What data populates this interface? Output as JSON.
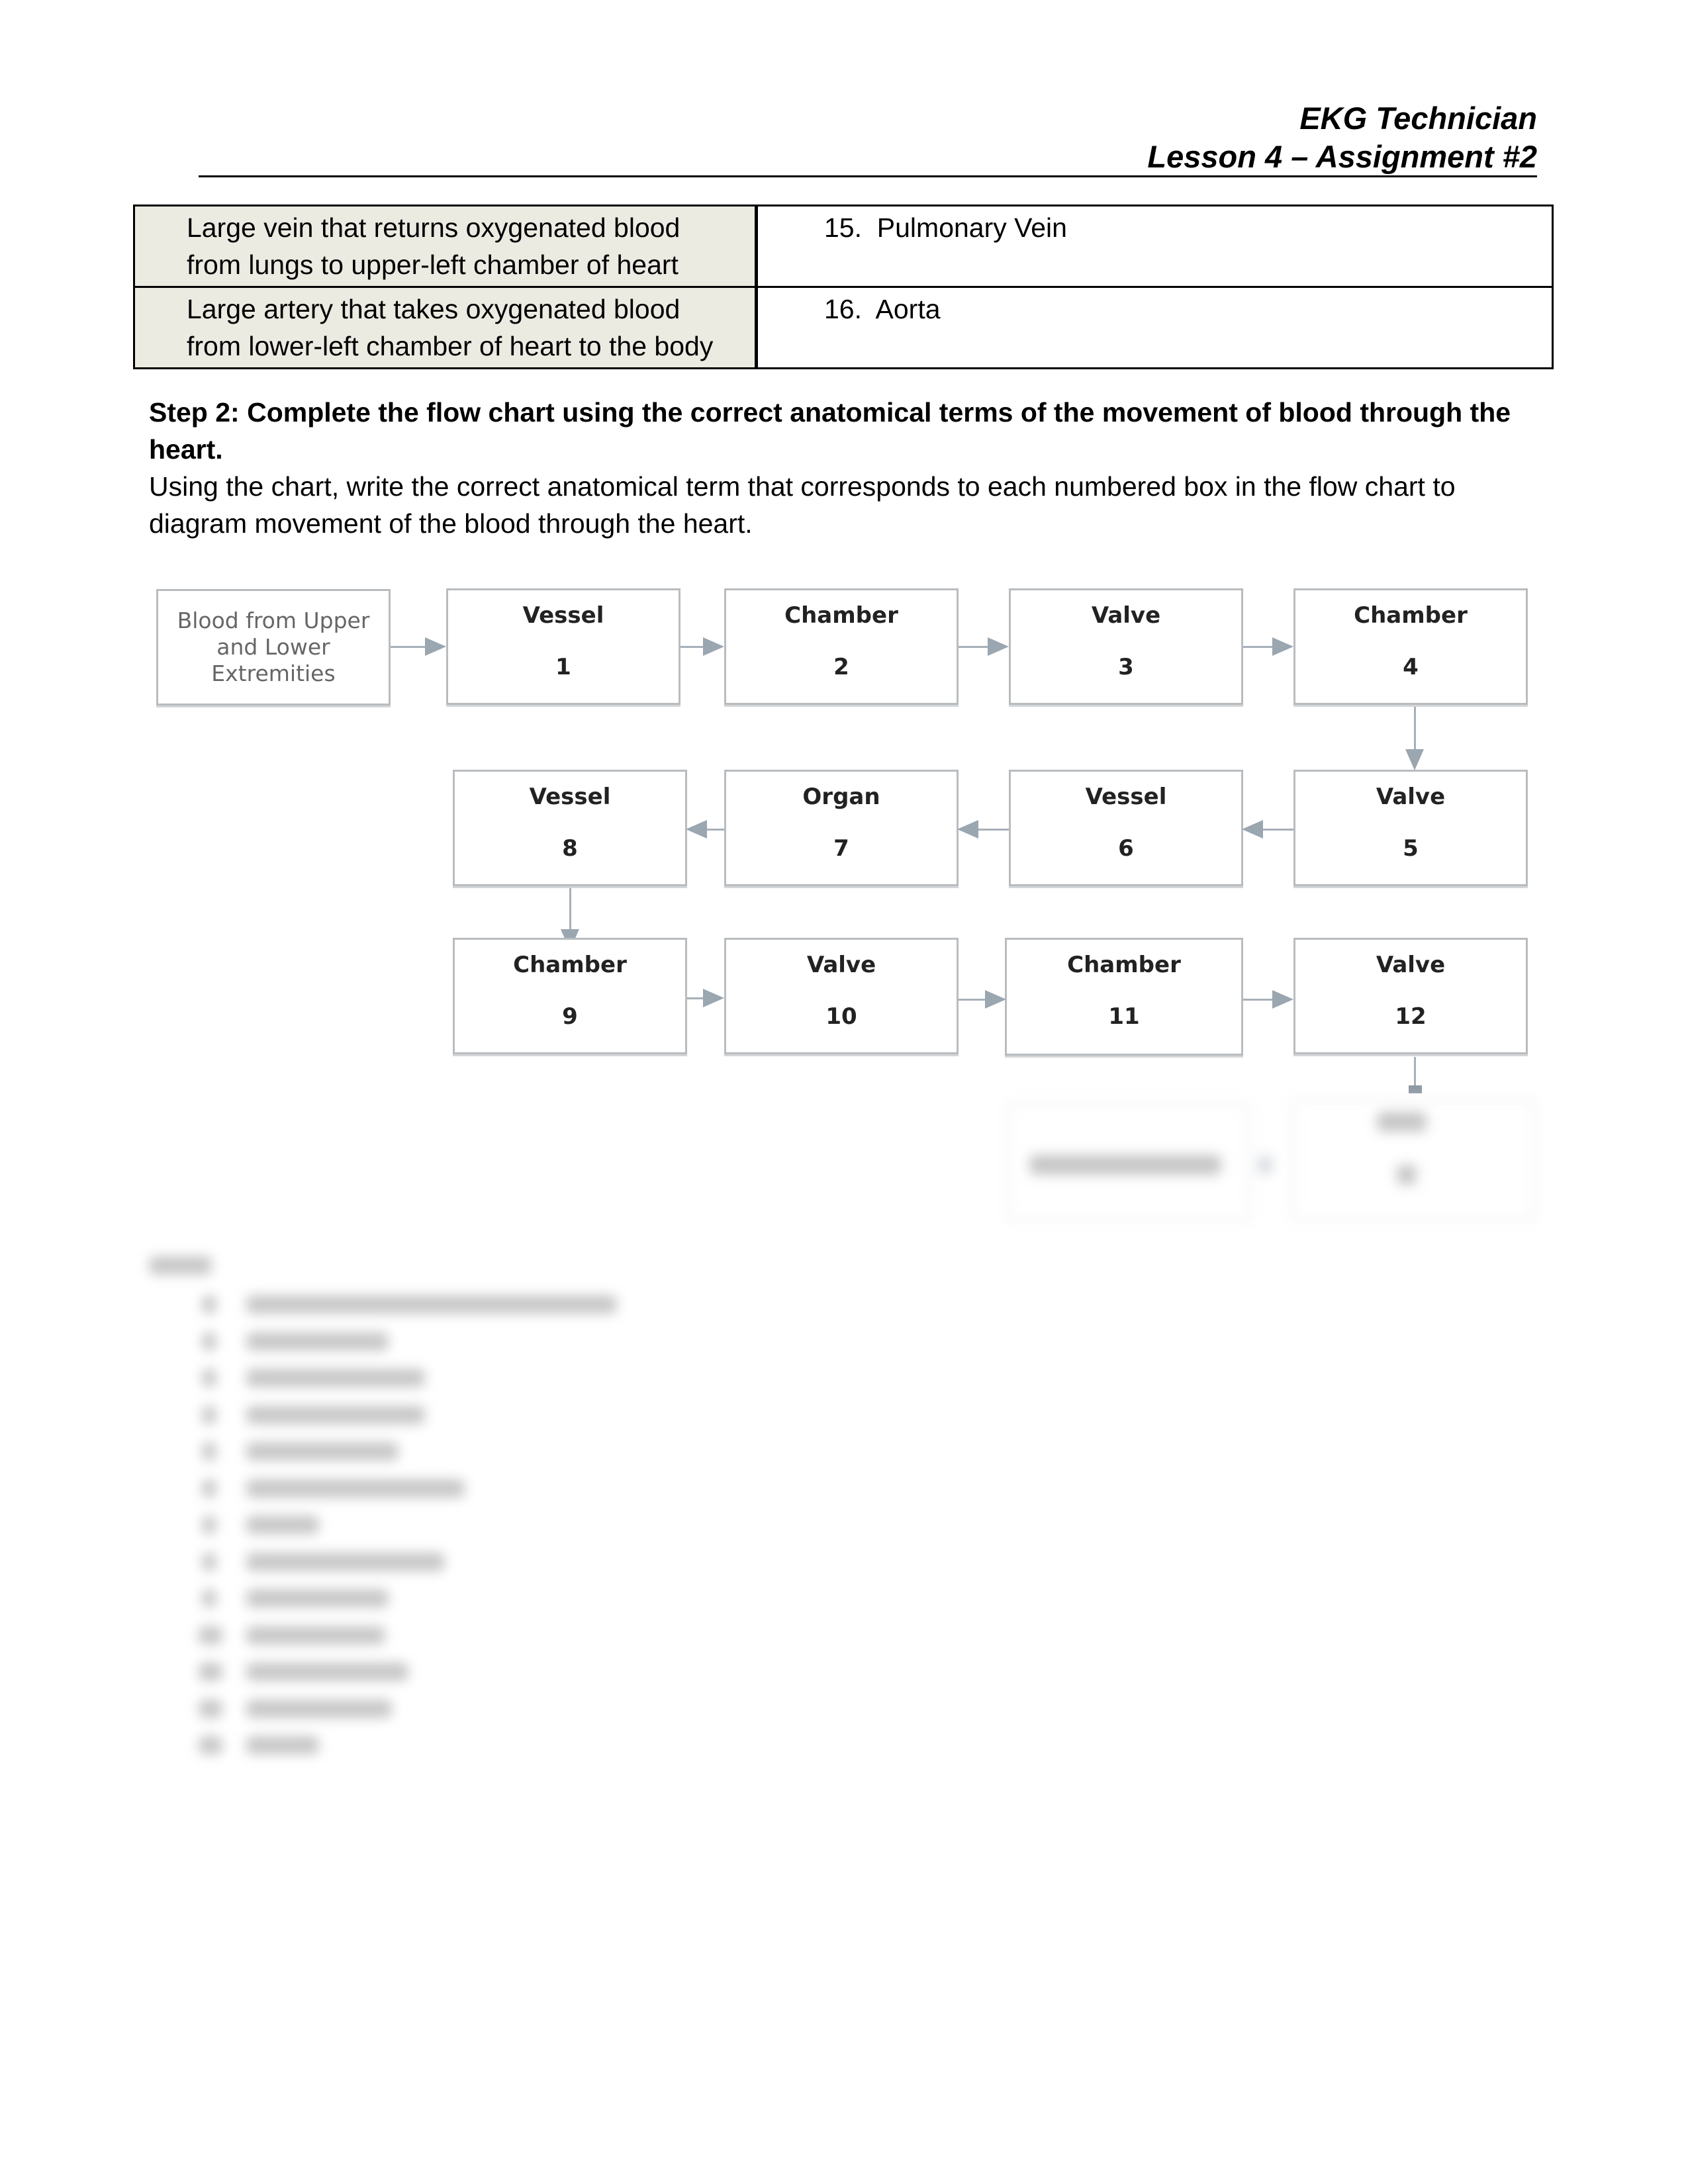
{
  "header": {
    "course": "EKG Technician",
    "lesson": "Lesson 4 – Assignment #2"
  },
  "terms_table": {
    "rows": [
      {
        "description_line1": "Large vein that returns oxygenated blood",
        "description_line2": "from lungs to upper-left chamber of heart",
        "answer": "15.  Pulmonary Vein"
      },
      {
        "description_line1": "Large artery that takes oxygenated blood",
        "description_line2": "from lower-left chamber of heart to the body",
        "answer": "16.  Aorta"
      }
    ]
  },
  "step2": {
    "heading": "Step 2: Complete the flow chart using the correct anatomical terms of the movement of blood through the heart.",
    "instructions": "Using the chart, write the correct anatomical term that corresponds to each numbered box in the flow chart to diagram movement of the blood through the heart."
  },
  "flowchart": {
    "start_box": {
      "line1": "Blood from Upper",
      "line2": "and Lower",
      "line3": "Extremities"
    },
    "steps": [
      {
        "category": "Vessel",
        "number": "1"
      },
      {
        "category": "Chamber",
        "number": "2"
      },
      {
        "category": "Valve",
        "number": "3"
      },
      {
        "category": "Chamber",
        "number": "4"
      },
      {
        "category": "Valve",
        "number": "5"
      },
      {
        "category": "Vessel",
        "number": "6"
      },
      {
        "category": "Organ",
        "number": "7"
      },
      {
        "category": "Vessel",
        "number": "8"
      },
      {
        "category": "Chamber",
        "number": "9"
      },
      {
        "category": "Valve",
        "number": "10"
      },
      {
        "category": "Chamber",
        "number": "11"
      },
      {
        "category": "Valve",
        "number": "12"
      }
    ],
    "blurred_section": "obscured"
  },
  "answers_section": {
    "state": "blurred",
    "visible_item_count": 13
  },
  "colors": {
    "table_description_bg": "#ecebe2",
    "box_border": "#b9bcbf",
    "arrow": "#9aa6b0"
  }
}
